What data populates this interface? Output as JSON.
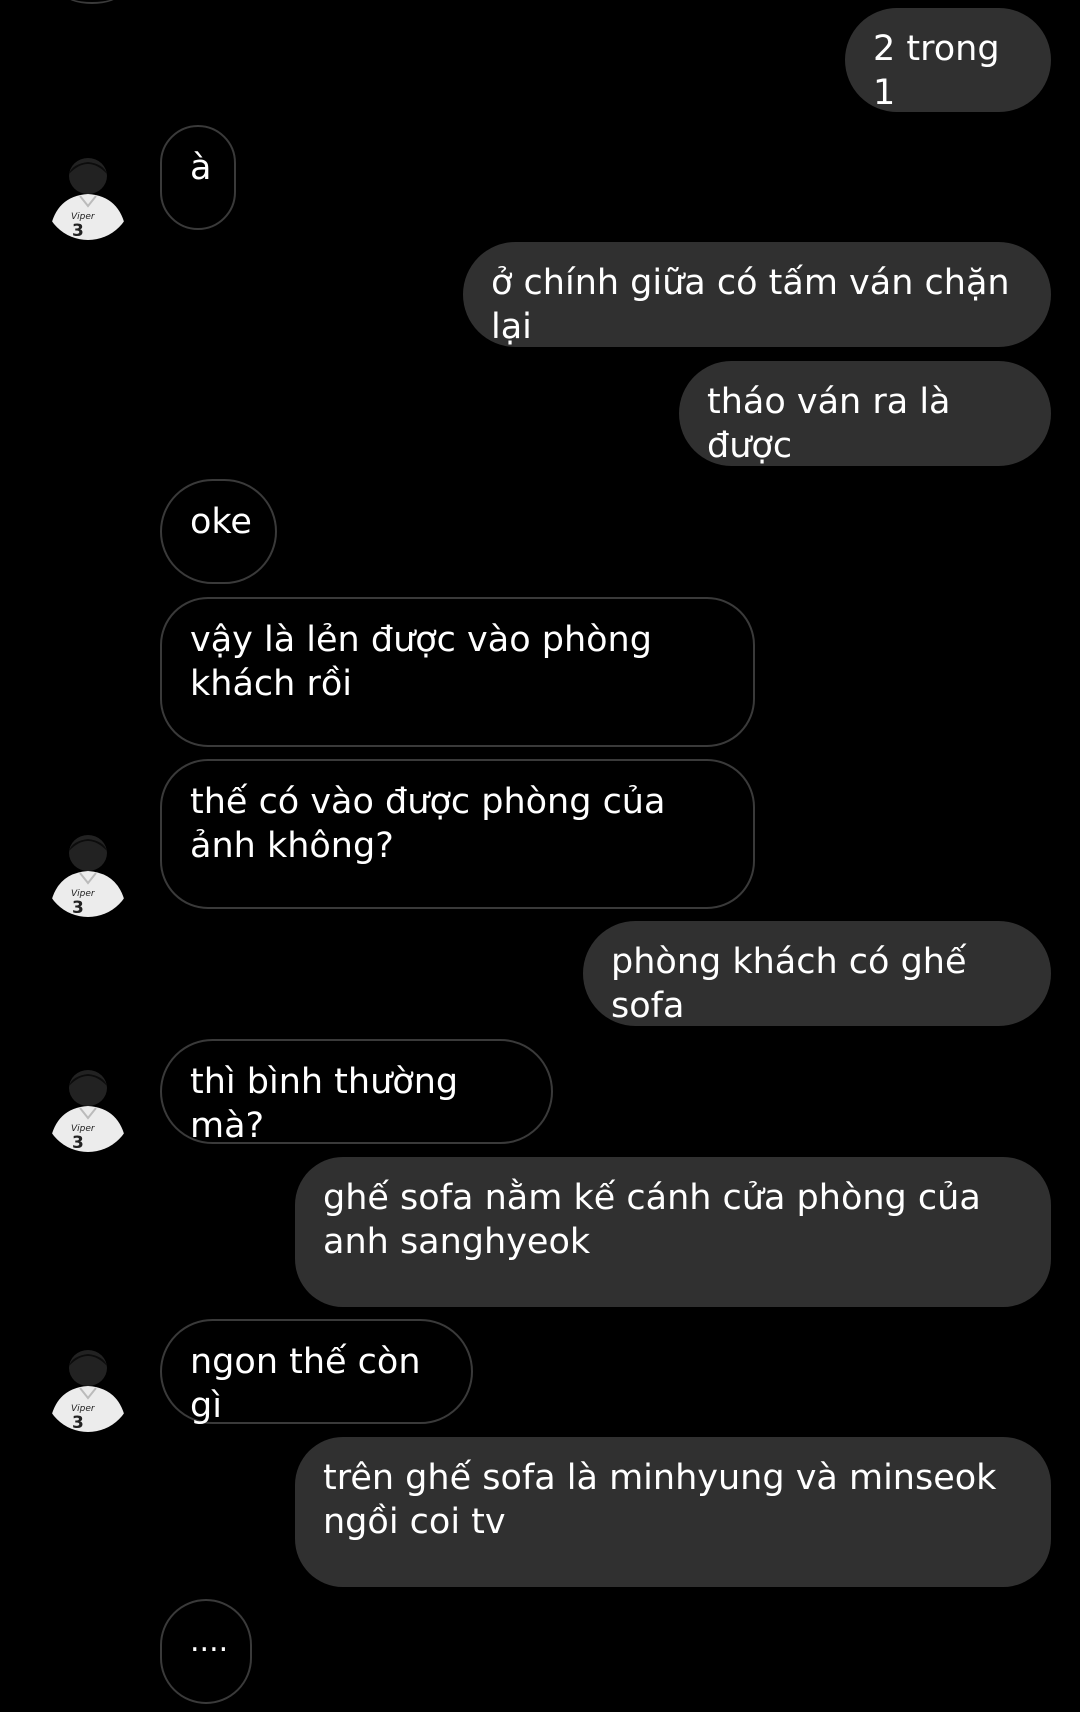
{
  "conversation": {
    "messages": [
      {
        "id": "m1",
        "direction": "sent",
        "text": "2 trong 1"
      },
      {
        "id": "m2",
        "direction": "received",
        "text": "à"
      },
      {
        "id": "m3",
        "direction": "sent",
        "text": "ở chính giữa có tấm ván chặn lại"
      },
      {
        "id": "m4",
        "direction": "sent",
        "text": "tháo ván ra là được"
      },
      {
        "id": "m5",
        "direction": "received",
        "text": "oke"
      },
      {
        "id": "m6",
        "direction": "received",
        "text": "vậy là lẻn được vào phòng khách rồi"
      },
      {
        "id": "m7",
        "direction": "received",
        "text": "thế có vào được phòng của ảnh không?"
      },
      {
        "id": "m8",
        "direction": "sent",
        "text": "phòng khách có ghế sofa"
      },
      {
        "id": "m9",
        "direction": "received",
        "text": "thì bình thường mà?"
      },
      {
        "id": "m10",
        "direction": "sent",
        "text": "ghế sofa nằm kế cánh cửa phòng của anh sanghyeok"
      },
      {
        "id": "m11",
        "direction": "received",
        "text": "ngon thế còn gì"
      },
      {
        "id": "m12",
        "direction": "sent",
        "text": "trên ghế sofa là minhyung và minseok ngồi coi tv"
      },
      {
        "id": "m13",
        "direction": "received",
        "text": "...."
      }
    ]
  },
  "avatar": {
    "jersey_name": "Viper",
    "jersey_number": "3"
  },
  "colors": {
    "background": "#000000",
    "sent_bubble": "#303030",
    "received_border": "#3a3a3a",
    "text": "#ffffff"
  }
}
